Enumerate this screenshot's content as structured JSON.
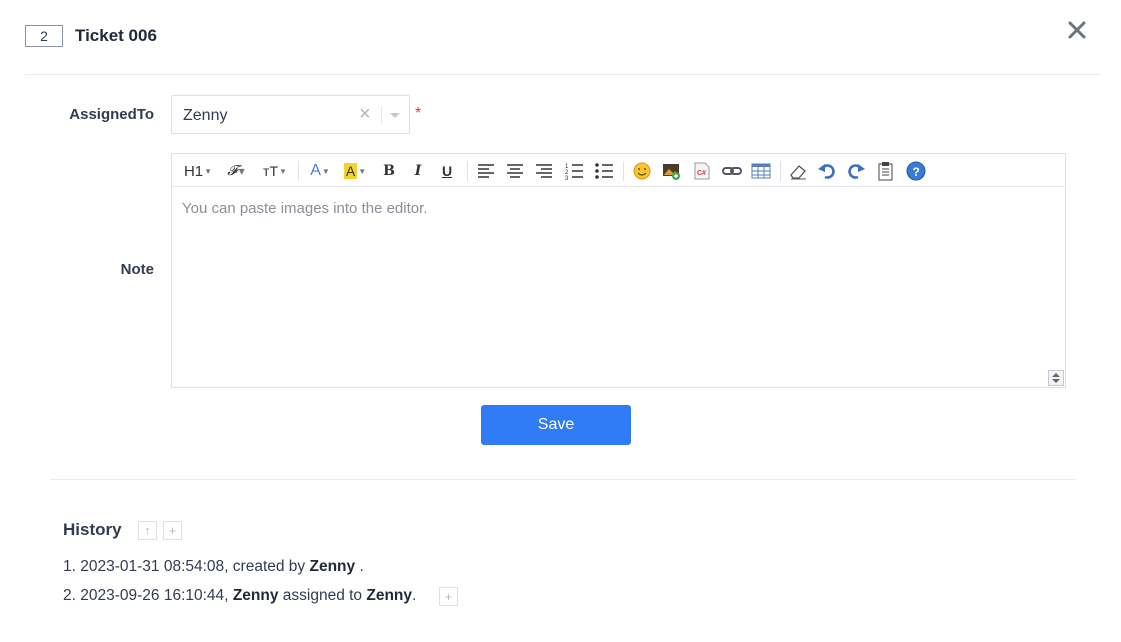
{
  "header": {
    "ticket_index": "2",
    "title": "Ticket 006",
    "close_icon": "close-icon"
  },
  "form": {
    "assigned_label": "AssignedTo",
    "assigned_value": "Zenny",
    "required_mark": "*",
    "note_label": "Note",
    "editor_placeholder": "You can paste images into the editor.",
    "toolbar": {
      "heading": "H1",
      "font_family": "𝓕",
      "font_size": "тT",
      "font_color": "A",
      "highlight": "A",
      "bold": "B",
      "italic": "I",
      "underline": "U"
    },
    "save_label": "Save"
  },
  "history": {
    "title": "History",
    "entries": [
      {
        "index": "1.",
        "time": "2023-01-31 08:54:08",
        "text1": ", created by ",
        "user": "Zenny",
        "text2": " ."
      },
      {
        "index": "2.",
        "time": "2023-09-26 16:10:44",
        "text1": ", ",
        "user": "Zenny",
        "text2": " assigned to ",
        "user2": "Zenny",
        "text3": "."
      }
    ]
  },
  "colors": {
    "primary": "#2f7cf6",
    "required": "#e03d3d",
    "text": "#313c52"
  }
}
